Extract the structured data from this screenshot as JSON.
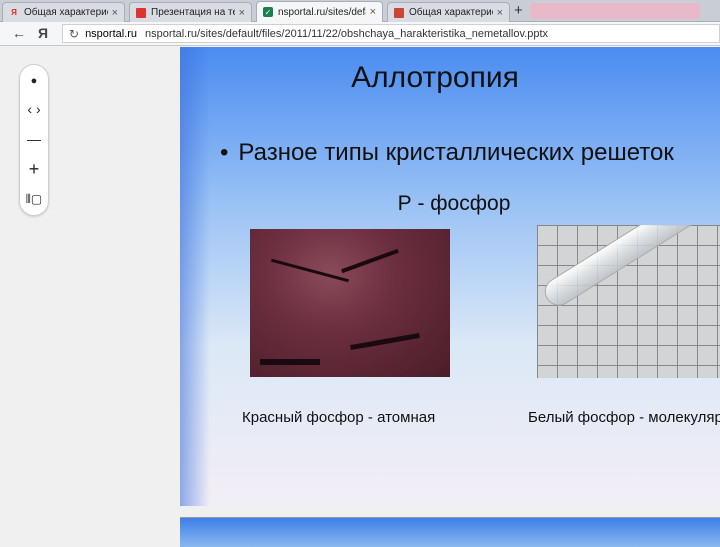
{
  "tabs": [
    {
      "title": "Общая характеристи",
      "favicon": "yandex-icon"
    },
    {
      "title": "Презентация на тему",
      "favicon": "doc-icon"
    },
    {
      "title": "nsportal.ru/sites/defa",
      "favicon": "check-icon",
      "active": true
    },
    {
      "title": "Общая характеристи",
      "favicon": "ppt-icon"
    }
  ],
  "new_tab_label": "+",
  "address": {
    "back": "←",
    "ya": "Я",
    "reload": "↻",
    "host": "nsportal.ru",
    "path": "nsportal.ru/sites/default/files/2011/11/22/obshchaya_harakteristika_nemetallov.pptx"
  },
  "zoom": {
    "dot": "●",
    "fit": "‹ ›",
    "minus": "—",
    "plus": "+",
    "pages": "⫴▢"
  },
  "slide": {
    "title": "Аллотропия",
    "bullet": "Разное типы кристаллических решеток",
    "subtitle": "Р - фосфор",
    "caption_left": "Красный фосфор - атомная",
    "caption_right": "Белый фосфор - молекулярная"
  },
  "colors": {
    "slide_top": "#4a8cf0",
    "slide_bottom": "#f3eef6"
  }
}
